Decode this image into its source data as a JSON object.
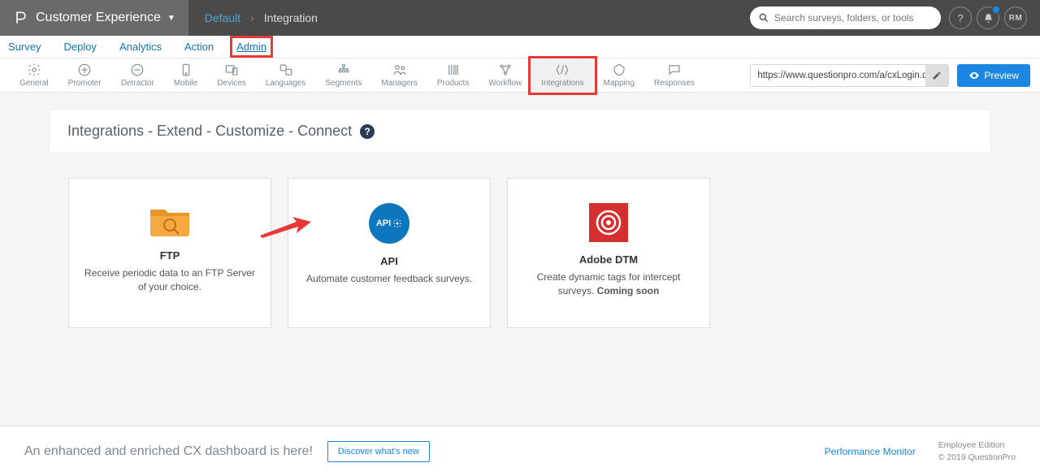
{
  "topbar": {
    "product_name": "Customer Experience",
    "breadcrumb": {
      "default": "Default",
      "current": "Integration"
    },
    "search_placeholder": "Search surveys, folders, or tools",
    "avatar_initials": "RM"
  },
  "maintabs": [
    "Survey",
    "Deploy",
    "Analytics",
    "Action",
    "Admin"
  ],
  "subtabs": [
    "General",
    "Promoter",
    "Detractor",
    "Mobile",
    "Devices",
    "Languages",
    "Segments",
    "Managers",
    "Products",
    "Workflow",
    "Integrations",
    "Mapping",
    "Responses"
  ],
  "url_box": "https://www.questionpro.com/a/cxLogin.d",
  "preview_label": "Preview",
  "page_title": "Integrations - Extend - Customize - Connect",
  "cards": [
    {
      "title": "FTP",
      "desc": "Receive periodic data to an FTP Server of your choice."
    },
    {
      "title": "API",
      "desc": "Automate customer feedback surveys."
    },
    {
      "title": "Adobe DTM",
      "desc": "Create dynamic tags for intercept surveys.",
      "suffix": "Coming soon"
    }
  ],
  "footer": {
    "msg": "An enhanced and enriched CX dashboard is here!",
    "discover": "Discover what's new",
    "perf": "Performance Monitor",
    "edition": "Employee Edition",
    "copyright": "© 2019 QuestionPro"
  }
}
